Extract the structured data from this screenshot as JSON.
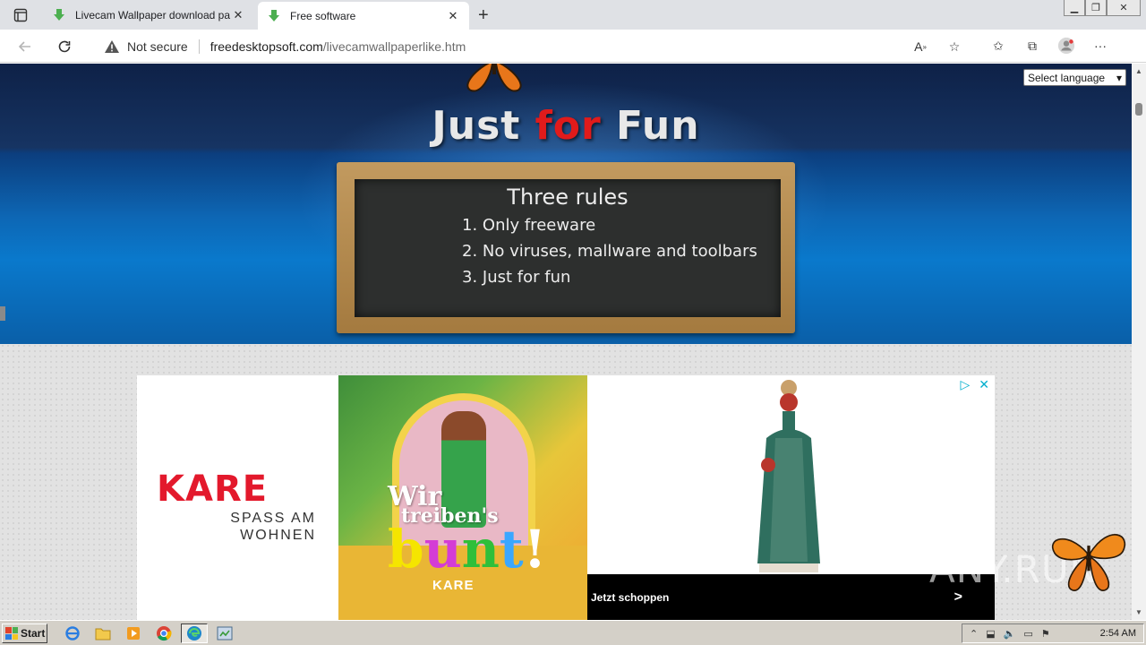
{
  "browser": {
    "tabs": [
      {
        "title": "Livecam Wallpaper download pa",
        "close": "✕"
      },
      {
        "title": "Free software",
        "close": "✕"
      }
    ],
    "new_tab": "+",
    "window_controls": {
      "minimize": "▁",
      "restore": "❐",
      "close": "✕"
    },
    "address": {
      "security_label": "Not secure",
      "domain": "freedesktopsoft.com",
      "path": "/livecamwallpaperlike.htm"
    }
  },
  "page": {
    "headline": {
      "part1": "Just ",
      "part2": "for",
      "part3": " Fun"
    },
    "language_select": {
      "label": "Select language",
      "arrow": "▾"
    },
    "chalkboard": {
      "title": "Three rules",
      "rules": [
        "1. Only freeware",
        "2. No viruses, mallware and toolbars",
        "3. Just for fun"
      ]
    },
    "ad": {
      "brand": "KARE",
      "tagline_lines": [
        "SPASS AM",
        "WOHNEN"
      ],
      "headline_line1": "Wir",
      "headline_line2": "treiben's",
      "headline_bunt": [
        "b",
        "u",
        "n",
        "t",
        "!"
      ],
      "brand_small": "KARE",
      "cta": "Jetzt schoppen",
      "cta_arrow": ">",
      "choices_icon": "▷",
      "close_icon": "✕"
    },
    "watermark": "ANY.RUN"
  },
  "taskbar": {
    "start_label": "Start",
    "time": "2:54 AM"
  },
  "colors": {
    "accent_red": "#e01b1b",
    "kare_red": "#e3192c",
    "hero_blue": "#0a79cc"
  }
}
